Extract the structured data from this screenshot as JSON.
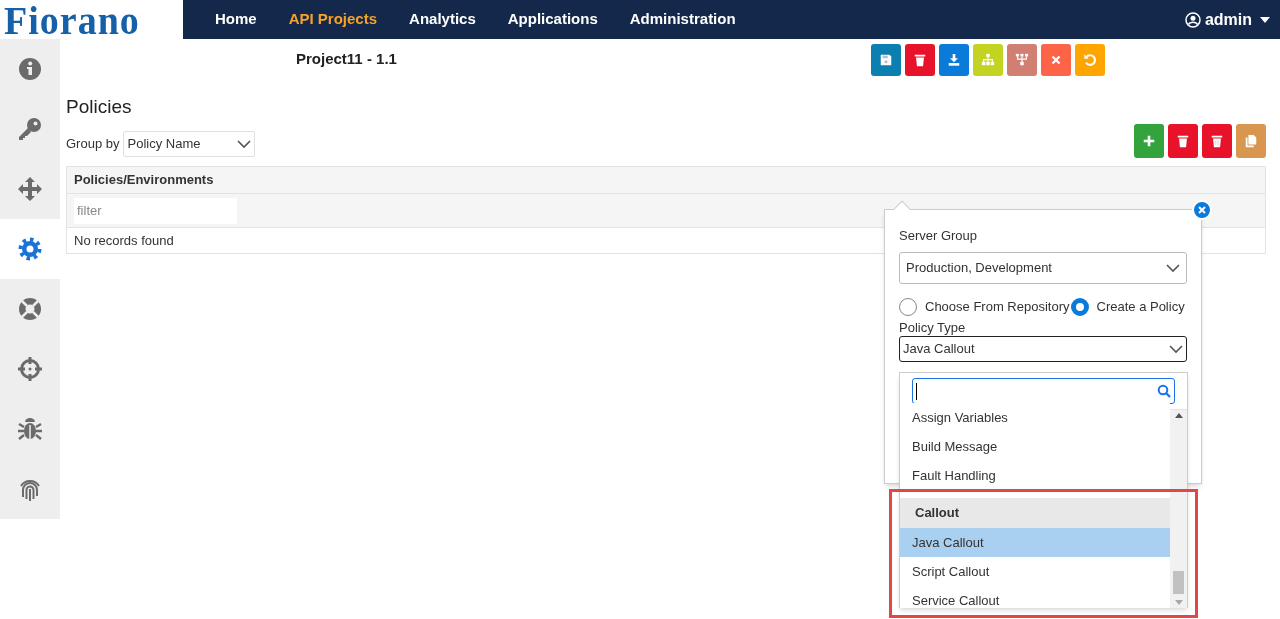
{
  "logo": {
    "text": "Fiorano"
  },
  "nav": {
    "items": [
      {
        "label": "Home",
        "selected": false
      },
      {
        "label": "API Projects",
        "selected": true
      },
      {
        "label": "Analytics",
        "selected": false
      },
      {
        "label": "Applications",
        "selected": false
      },
      {
        "label": "Administration",
        "selected": false
      }
    ],
    "user": {
      "label": "admin"
    }
  },
  "sidebar": {
    "items": [
      {
        "selected": false
      },
      {
        "selected": false
      },
      {
        "selected": false
      },
      {
        "selected": true
      },
      {
        "selected": false
      },
      {
        "selected": false
      },
      {
        "selected": false
      },
      {
        "selected": false
      }
    ]
  },
  "project_title": "Project11 - 1.1",
  "toolbar": {
    "buttons": [
      {
        "color": "#0b7fb0"
      },
      {
        "color": "#e8132a"
      },
      {
        "color": "#0a7bd8"
      },
      {
        "color": "#c3d321"
      },
      {
        "color": "#d17f72"
      },
      {
        "color": "#fd6347"
      },
      {
        "color": "#ffa500"
      }
    ]
  },
  "policies": {
    "title": "Policies",
    "group_by": {
      "label": "Group by",
      "value": "Policy Name"
    },
    "actions": [
      {
        "color": "#33a33b"
      },
      {
        "color": "#e8132a"
      },
      {
        "color": "#e8132a"
      },
      {
        "color": "#d9964e"
      }
    ],
    "table": {
      "columns": [
        "Policies/Environments"
      ],
      "filter_placeholder": "filter",
      "empty_message": "No records found"
    }
  },
  "popover": {
    "server_group": {
      "label": "Server Group",
      "value": "Production, Development"
    },
    "source_options": [
      {
        "label": "Choose From Repository",
        "selected": false
      },
      {
        "label": "Create a Policy",
        "selected": true
      }
    ],
    "policy_type": {
      "label": "Policy Type",
      "value": "Java Callout",
      "expanded": true
    },
    "dropdown": {
      "highlighted": true,
      "items": [
        {
          "kind": "option",
          "label": "Assign Variables",
          "selected": false
        },
        {
          "kind": "option",
          "label": "Build Message",
          "selected": false
        },
        {
          "kind": "option",
          "label": "Fault Handling",
          "selected": false
        },
        {
          "kind": "group",
          "label": "Callout"
        },
        {
          "kind": "option",
          "label": "Java Callout",
          "selected": true
        },
        {
          "kind": "option",
          "label": "Script Callout",
          "selected": false
        },
        {
          "kind": "option",
          "label": "Service Callout",
          "selected": false
        }
      ]
    }
  }
}
